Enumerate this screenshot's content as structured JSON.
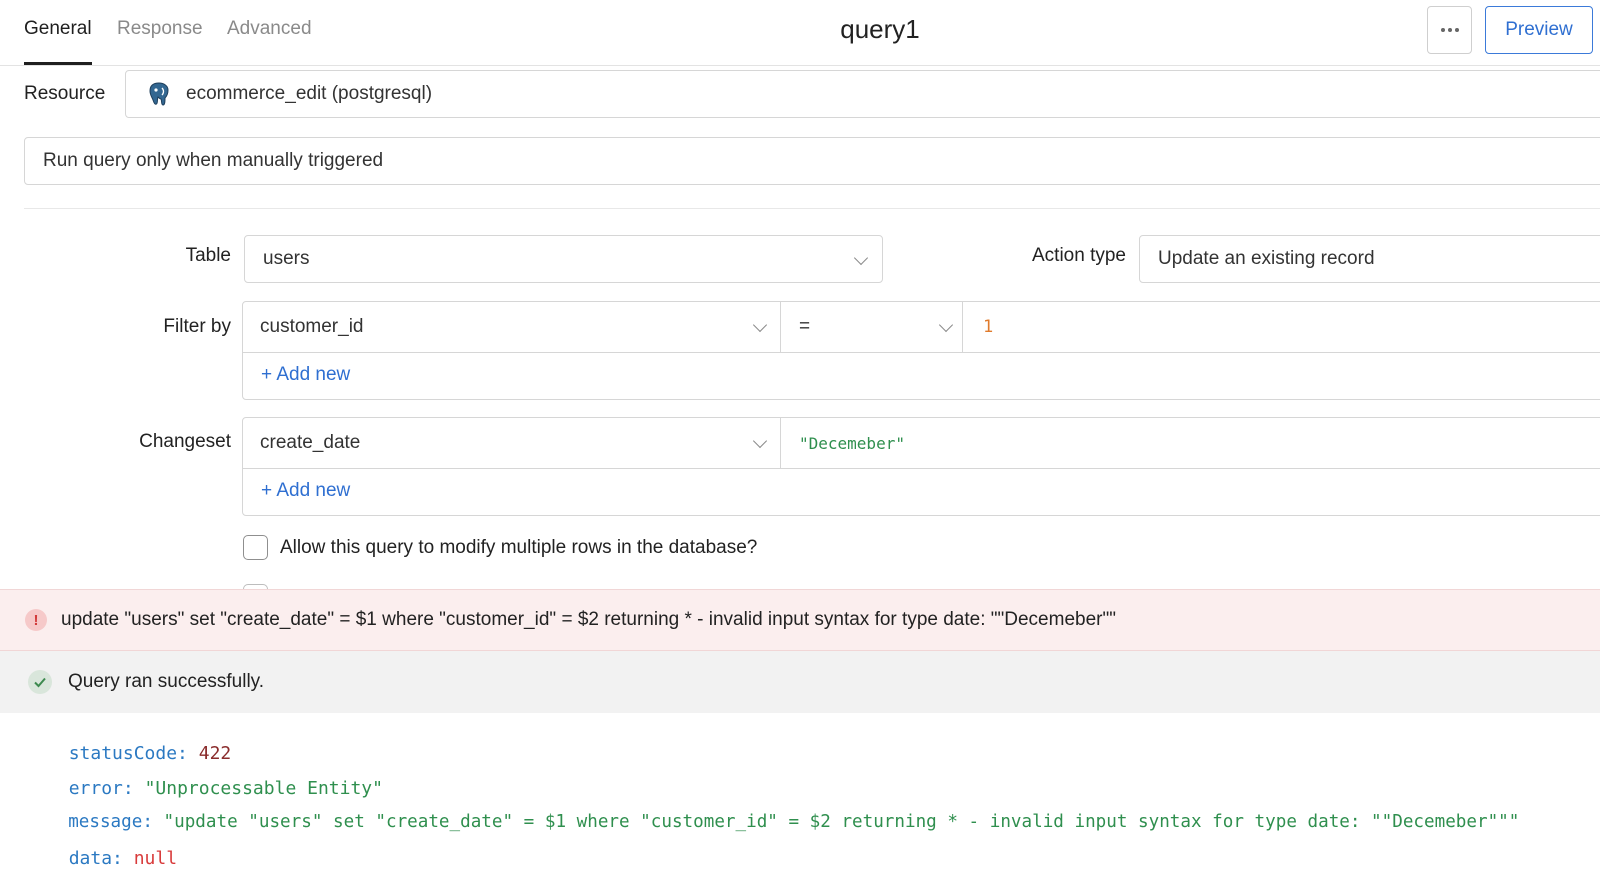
{
  "header": {
    "tabs": [
      "General",
      "Response",
      "Advanced"
    ],
    "active_tab": "General",
    "title": "query1",
    "more_icon": "more-horizontal-icon",
    "preview_label": "Preview"
  },
  "resource": {
    "label": "Resource",
    "value": "ecommerce_edit (postgresql)",
    "icon": "postgresql-icon"
  },
  "trigger": {
    "value": "Run query only when manually triggered"
  },
  "form": {
    "table_label": "Table",
    "table_value": "users",
    "action_type_label": "Action type",
    "action_type_value": "Update an existing record",
    "filter_label": "Filter by",
    "filter_column": "customer_id",
    "filter_operator": "=",
    "filter_value": "1",
    "filter_add_new": "+ Add new",
    "changeset_label": "Changeset",
    "changeset_column": "create_date",
    "changeset_value": "\"Decemeber\"",
    "changeset_add_new": "+ Add new",
    "allow_multiple_label": "Allow this query to modify multiple rows in the database?"
  },
  "error_banner": {
    "text": "update \"users\" set \"create_date\" = $1 where \"customer_id\" = $2 returning * - invalid input syntax for type date: \"\"Decemeber\"\""
  },
  "success_banner": {
    "text": "Query ran successfully."
  },
  "response": {
    "statusCode_key": "statusCode:",
    "statusCode_value": "422",
    "error_key": "error:",
    "error_value": "\"Unprocessable Entity\"",
    "message_key": "message:",
    "message_value": "\"update \"users\" set \"create_date\" = $1 where \"customer_id\" = $2 returning * - invalid input syntax for type date: \"\"Decemeber\"\"\"",
    "data_key": "data:",
    "data_value": "null"
  },
  "colors": {
    "accent": "#2f6fd1",
    "error_bg": "#fbeeee",
    "success_bg": "#f2f2f2",
    "number": "#e07b2c",
    "string": "#2f8f4e"
  }
}
